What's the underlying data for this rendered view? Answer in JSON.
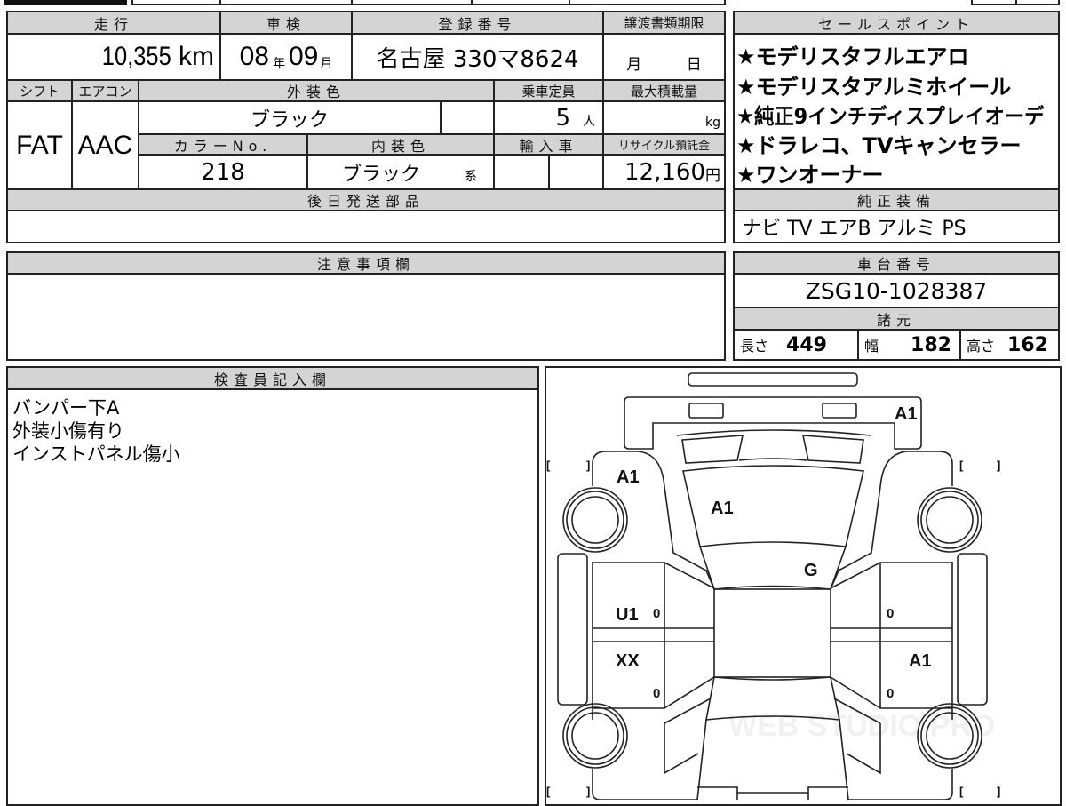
{
  "header_table": {
    "mileage_label": "走行",
    "mileage_value": "10,355",
    "mileage_unit": "km",
    "inspection_label": "車検",
    "inspection_year": "08",
    "year_unit": "年",
    "inspection_month": "09",
    "month_unit": "月",
    "registration_label": "登録番号",
    "registration_value": "名古屋 330マ8624",
    "transfer_doc_label": "譲渡書類期限",
    "transfer_month_unit": "月",
    "transfer_day_unit": "日",
    "shift_label": "シフト",
    "shift_value": "FAT",
    "ac_label": "エアコン",
    "ac_value": "AAC",
    "exterior_color_label": "外装色",
    "exterior_color_value": "ブラック",
    "capacity_label": "乗車定員",
    "capacity_value": "5",
    "capacity_unit": "人",
    "max_load_label": "最大積載量",
    "max_load_unit": "kg",
    "color_no_label": "カラーNo.",
    "color_no_value": "218",
    "interior_color_label": "内装色",
    "interior_color_value": "ブラック",
    "interior_color_suffix": "系",
    "import_label": "輸入車",
    "recycle_label": "リサイクル預託金",
    "recycle_value": "12,160",
    "recycle_unit": "円",
    "later_parts_label": "後日発送部品"
  },
  "sales_points": {
    "label": "セールスポイント",
    "items": [
      "★モデリスタフルエアロ",
      "★モデリスタアルミホイール",
      "★純正9インチディスプレイオーデ",
      "★ドラレコ、TVキャンセラー",
      "★ワンオーナー"
    ]
  },
  "equipment": {
    "label": "純正装備",
    "value": "ナビ TV エアB アルミ PS"
  },
  "notes": {
    "label": "注意事項欄"
  },
  "chassis": {
    "label": "車台番号",
    "value": "ZSG10-1028387"
  },
  "specs": {
    "label": "諸元",
    "length_label": "長さ",
    "length": "449",
    "width_label": "幅",
    "width": "182",
    "height_label": "高さ",
    "height": "162"
  },
  "inspector": {
    "label": "検査員記入欄",
    "lines": [
      "バンパー下A",
      "外装小傷有り",
      "インストパネル傷小"
    ]
  },
  "diagram": {
    "marks": {
      "rear_bumper": "A1",
      "left_rear_quarter": "A1",
      "rear_glass": "A1",
      "roof_front": "G",
      "left_rear_door": "U1",
      "left_front_door": "XX",
      "right_front_door": "A1",
      "door_zero": "0"
    },
    "watermark": "WEB STUDIO PRO"
  }
}
